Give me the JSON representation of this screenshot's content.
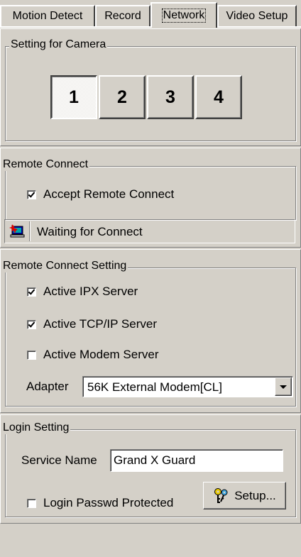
{
  "tabs": [
    {
      "label": "Motion Detect",
      "active": false
    },
    {
      "label": "Record",
      "active": false
    },
    {
      "label": "Network",
      "active": true
    },
    {
      "label": "Video Setup",
      "active": false
    }
  ],
  "camera_setting": {
    "title": "Setting for Camera",
    "buttons": [
      {
        "label": "1",
        "pressed": true
      },
      {
        "label": "2",
        "pressed": false
      },
      {
        "label": "3",
        "pressed": false
      },
      {
        "label": "4",
        "pressed": false
      }
    ]
  },
  "remote_connect": {
    "title": "Remote Connect",
    "accept_label": "Accept Remote Connect",
    "accept_checked": true,
    "status_icon": "connection-status-icon",
    "status_text": "Waiting for Connect"
  },
  "remote_connect_setting": {
    "title": "Remote Connect Setting",
    "options": [
      {
        "label": "Active IPX Server",
        "checked": true
      },
      {
        "label": "Active TCP/IP Server",
        "checked": true
      },
      {
        "label": "Active Modem Server",
        "checked": false
      }
    ],
    "adapter_label": "Adapter",
    "adapter_value": "56K External Modem[CL]"
  },
  "login_setting": {
    "title": "Login Setting",
    "service_name_label": "Service Name",
    "service_name_value": "Grand X Guard",
    "passwd_label": "Login Passwd Protected",
    "passwd_checked": false,
    "setup_label": "Setup...",
    "setup_icon": "keys-icon"
  },
  "colors": {
    "face": "#d4d0c8",
    "highlight": "#ffffff",
    "shadow": "#808080",
    "dark_shadow": "#404040"
  }
}
